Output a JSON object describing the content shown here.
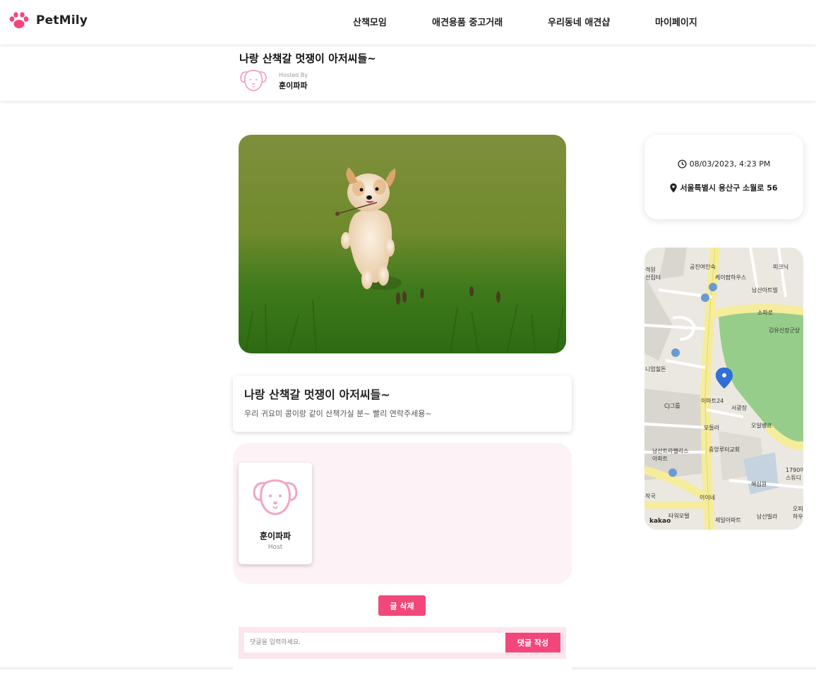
{
  "header": {
    "brand": "PetMily",
    "nav": [
      "산책모임",
      "애견용품 중고거래",
      "우리동네 애견샵",
      "마이페이지"
    ]
  },
  "post": {
    "title": "나랑 산책갈 멋쟁이 아저씨들~",
    "hosted_by_label": "Hosted By",
    "host_name": "훈이파파"
  },
  "info": {
    "datetime": "08/03/2023, 4:23 PM",
    "address": "서울특별시 용산구 소월로 56"
  },
  "map": {
    "labels": [
      "공진여인숙",
      "피크닉",
      "케이팝하우스",
      "남산아트빌",
      "소파로",
      "김유신장군상",
      "니엄힐튼",
      "이마트24",
      "서광장",
      "CJ그룹",
      "모들러",
      "오일뱅크",
      "중앙루터교회",
      "남산트라팰리스아파트",
      "혜심원",
      "1790아스튜디",
      "이이네",
      "타워모텔",
      "제일아파트",
      "남산빌라",
      "오피하우스"
    ],
    "logo": "kakao"
  },
  "content": {
    "title": "나랑 산책갈 멋쟁이 아저씨들~",
    "body": "우리 귀요미 콩이랑 같이 산책가실 분~ 빨리 연락주세용~"
  },
  "participants": [
    {
      "name": "훈이파파",
      "role": "Host"
    }
  ],
  "actions": {
    "delete_label": "글 삭제",
    "comment_placeholder": "댓글을 입력하세요.",
    "comment_submit_label": "댓글 작성"
  },
  "colors": {
    "accent": "#f2477a",
    "avatar_pink": "#f4a6bf",
    "participants_bg": "#fdf2f6",
    "comment_bg": "#fbe6ee"
  },
  "icons": [
    "paw-icon",
    "dog-avatar-icon",
    "clock-icon",
    "map-pin-icon",
    "map-marker-icon"
  ]
}
